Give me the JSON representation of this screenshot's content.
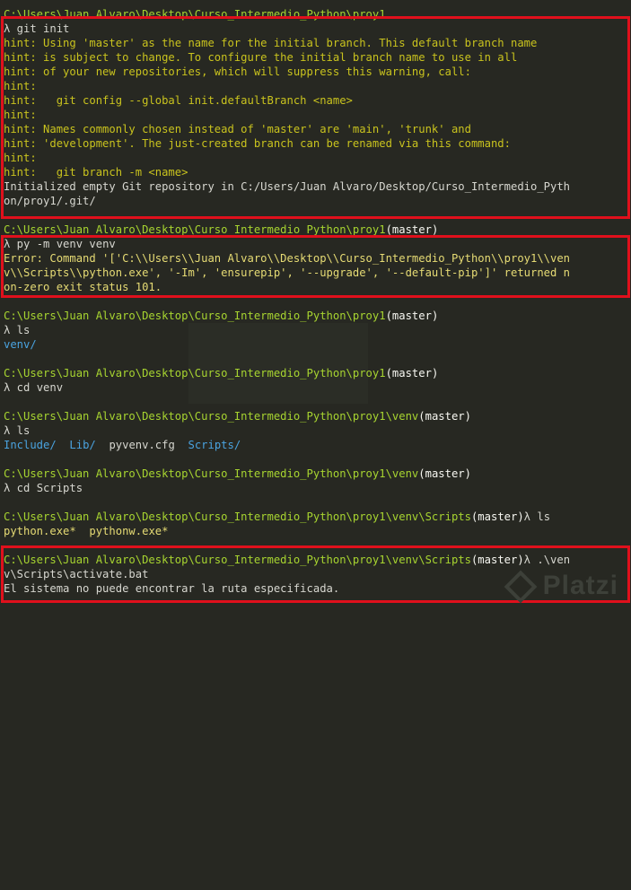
{
  "prompt_path_1": "C:\\Users\\Juan Alvaro\\Desktop\\Curso_Intermedio_Python\\proy1",
  "prompt_path_venv": "C:\\Users\\Juan Alvaro\\Desktop\\Curso_Intermedio_Python\\proy1\\venv",
  "prompt_path_scripts": "C:\\Users\\Juan Alvaro\\Desktop\\Curso_Intermedio_Python\\proy1\\venv\\Scripts",
  "branch": "(master)",
  "lambda": "λ",
  "commands": {
    "git_init": " git init",
    "py_venv": " py -m venv venv",
    "ls": " ls",
    "cd_venv": " cd venv",
    "cd_scripts": " cd Scripts",
    "activate": " .\\ven",
    "activate_cont": "v\\Scripts\\activate.bat"
  },
  "hints": [
    "hint: Using 'master' as the name for the initial branch. This default branch name",
    "hint: is subject to change. To configure the initial branch name to use in all",
    "hint: of your new repositories, which will suppress this warning, call:",
    "hint:",
    "hint:   git config --global init.defaultBranch <name>",
    "hint:",
    "hint: Names commonly chosen instead of 'master' are 'main', 'trunk' and",
    "hint: 'development'. The just-created branch can be renamed via this command:",
    "hint:",
    "hint:   git branch -m <name>"
  ],
  "init_msg_1": "Initialized empty Git repository in C:/Users/Juan Alvaro/Desktop/Curso_Intermedio_Pyth",
  "init_msg_2": "on/proy1/.git/",
  "error_lines": [
    "Error: Command '['C:\\\\Users\\\\Juan Alvaro\\\\Desktop\\\\Curso_Intermedio_Python\\\\proy1\\\\ven",
    "v\\\\Scripts\\\\python.exe', '-Im', 'ensurepip', '--upgrade', '--default-pip']' returned n",
    "on-zero exit status 101."
  ],
  "ls_proy1": "venv/",
  "ls_venv": {
    "include": "Include/",
    "lib": "Lib/",
    "cfg": "pyvenv.cfg",
    "scripts": "Scripts/"
  },
  "ls_scripts": {
    "python": "python.exe*",
    "pythonw": "pythonw.exe*"
  },
  "not_found": "El sistema no puede encontrar la ruta especificada.",
  "watermark": "Platzi"
}
